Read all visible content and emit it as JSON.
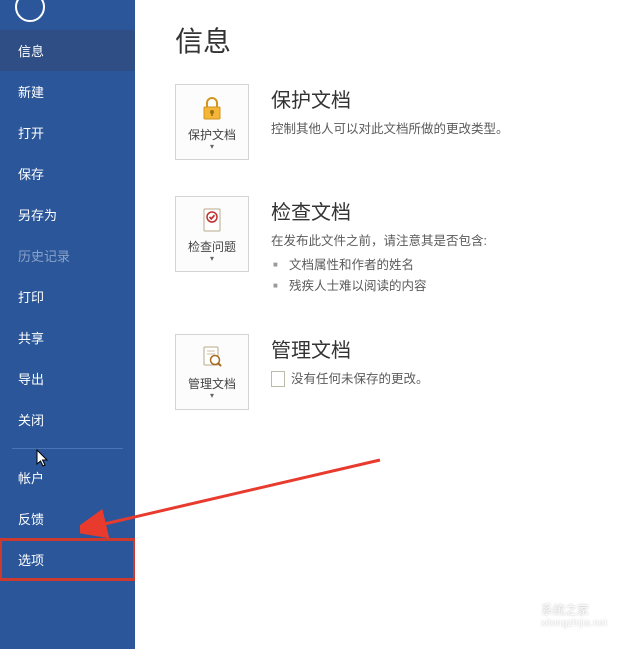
{
  "sidebar": {
    "items": [
      {
        "label": "信息",
        "name": "sidebar-item-info",
        "active": true
      },
      {
        "label": "新建",
        "name": "sidebar-item-new"
      },
      {
        "label": "打开",
        "name": "sidebar-item-open"
      },
      {
        "label": "保存",
        "name": "sidebar-item-save"
      },
      {
        "label": "另存为",
        "name": "sidebar-item-saveas"
      },
      {
        "label": "历史记录",
        "name": "sidebar-item-history",
        "dim": true
      },
      {
        "label": "打印",
        "name": "sidebar-item-print"
      },
      {
        "label": "共享",
        "name": "sidebar-item-share"
      },
      {
        "label": "导出",
        "name": "sidebar-item-export"
      },
      {
        "label": "关闭",
        "name": "sidebar-item-close"
      }
    ],
    "bottom_items": [
      {
        "label": "帐户",
        "name": "sidebar-item-account"
      },
      {
        "label": "反馈",
        "name": "sidebar-item-feedback"
      },
      {
        "label": "选项",
        "name": "sidebar-item-options",
        "highlighted": true
      }
    ]
  },
  "page": {
    "title": "信息"
  },
  "sections": {
    "protect": {
      "tile_label": "保护文档",
      "title": "保护文档",
      "desc": "控制其他人可以对此文档所做的更改类型。"
    },
    "inspect": {
      "tile_label": "检查问题",
      "title": "检查文档",
      "desc": "在发布此文件之前，请注意其是否包含:",
      "bullets": [
        "文档属性和作者的姓名",
        "残疾人士难以阅读的内容"
      ]
    },
    "manage": {
      "tile_label": "管理文档",
      "title": "管理文档",
      "desc": "没有任何未保存的更改。"
    }
  },
  "watermark": {
    "title": "系统之家",
    "sub": "xitongzhijia.net"
  }
}
